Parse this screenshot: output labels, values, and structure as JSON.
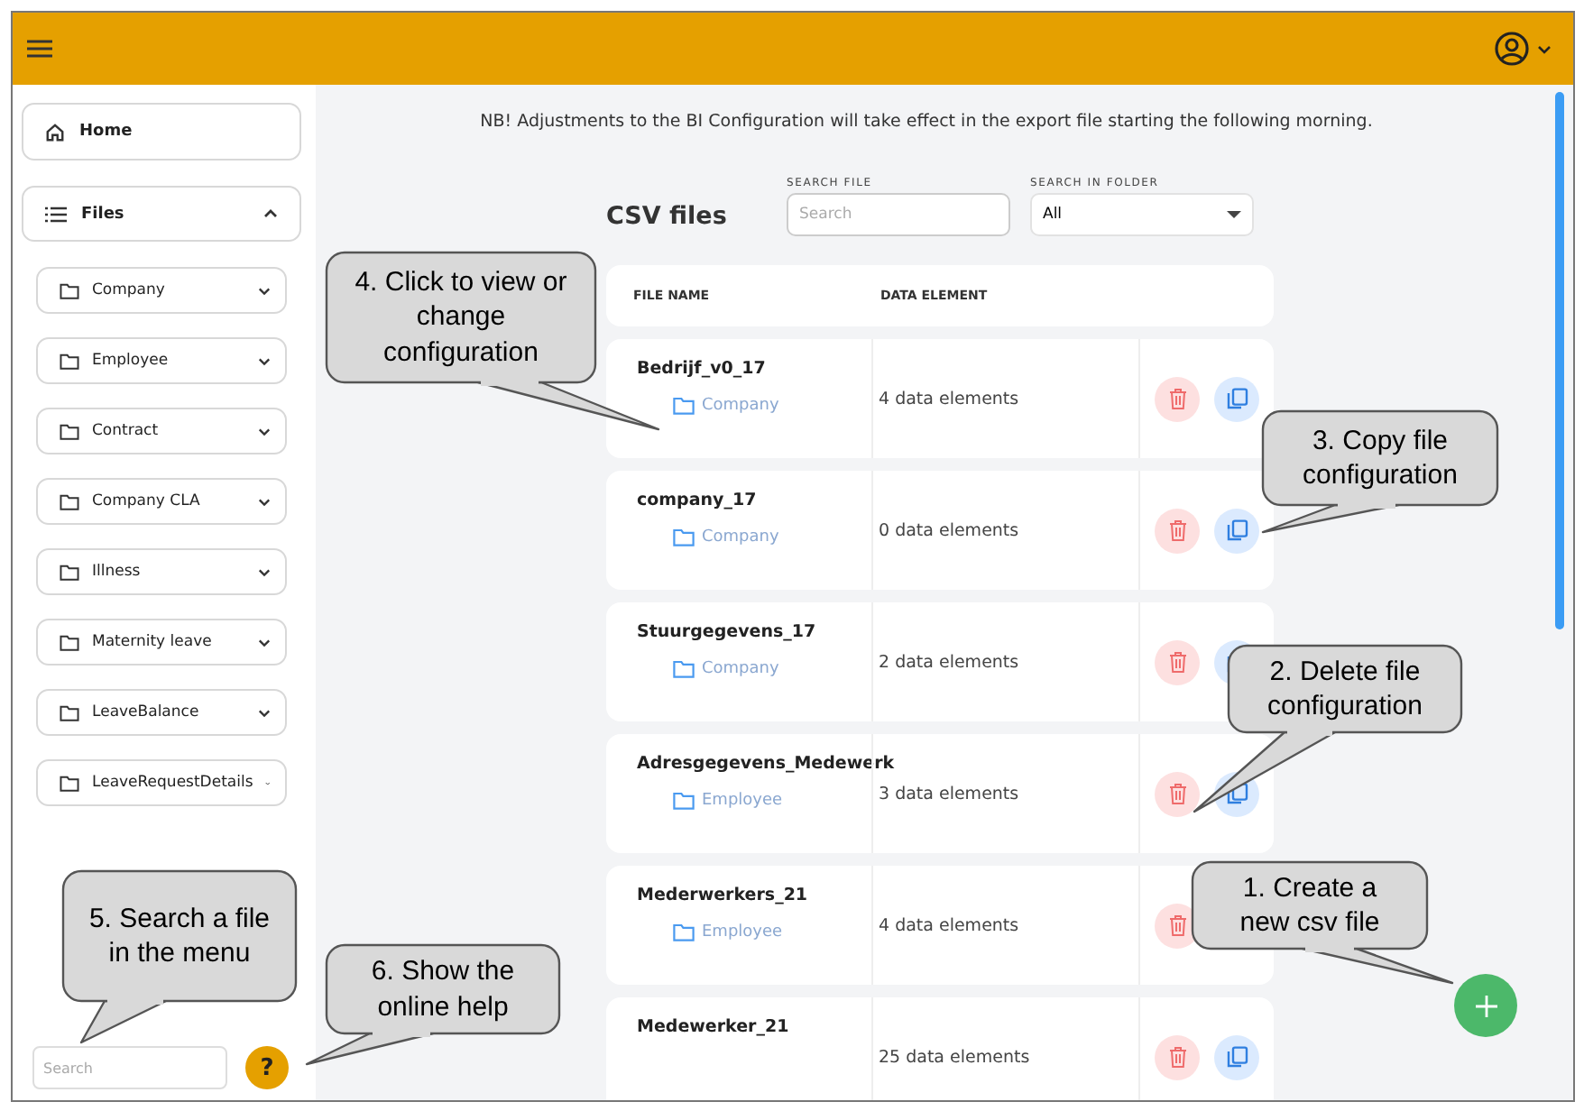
{
  "sidebar": {
    "home": {
      "label": "Home"
    },
    "files": {
      "label": "Files",
      "expanded": true,
      "folders": [
        {
          "label": "Company",
          "expanded": false
        },
        {
          "label": "Employee",
          "expanded": false
        },
        {
          "label": "Contract",
          "expanded": false
        },
        {
          "label": "Company CLA",
          "expanded": false
        },
        {
          "label": "Illness",
          "expanded": false
        },
        {
          "label": "Maternity leave",
          "expanded": false
        },
        {
          "label": "LeaveBalance",
          "expanded": false
        },
        {
          "label": "LeaveRequestDetails",
          "expanded": false
        }
      ]
    },
    "search": {
      "placeholder": "Search"
    },
    "help": {
      "label": "?"
    }
  },
  "notice": "NB! Adjustments to the BI Configuration will take effect in the export file starting the following morning.",
  "page_title": "CSV files",
  "search_file": {
    "label": "SEARCH FILE",
    "placeholder": "Search"
  },
  "folder_filter": {
    "label": "SEARCH IN FOLDER",
    "value": "All"
  },
  "table": {
    "columns": [
      "FILE NAME",
      "DATA ELEMENT"
    ],
    "rows": [
      {
        "name": "Bedrijf_v0_17",
        "folder": "Company",
        "count": "4 data elements"
      },
      {
        "name": "company_17",
        "folder": "Company",
        "count": "0 data elements"
      },
      {
        "name": "Stuurgegevens_17",
        "folder": "Company",
        "count": "2 data elements"
      },
      {
        "name": "Adresgegevens_Medewerk",
        "folder": "Employee",
        "count": "3 data elements"
      },
      {
        "name": "Mederwerkers_21",
        "folder": "Employee",
        "count": "4 data elements"
      },
      {
        "name": "Medewerker_21",
        "count": "25 data elements"
      }
    ]
  },
  "callouts": [
    {
      "text": "4. Click to view or change configuration"
    },
    {
      "text": "3. Copy file configuration"
    },
    {
      "text": "2. Delete file configuration"
    },
    {
      "text": "1. Create a new csv file"
    },
    {
      "text": "5. Search a file in the menu"
    },
    {
      "text": "6. Show the online help"
    }
  ]
}
